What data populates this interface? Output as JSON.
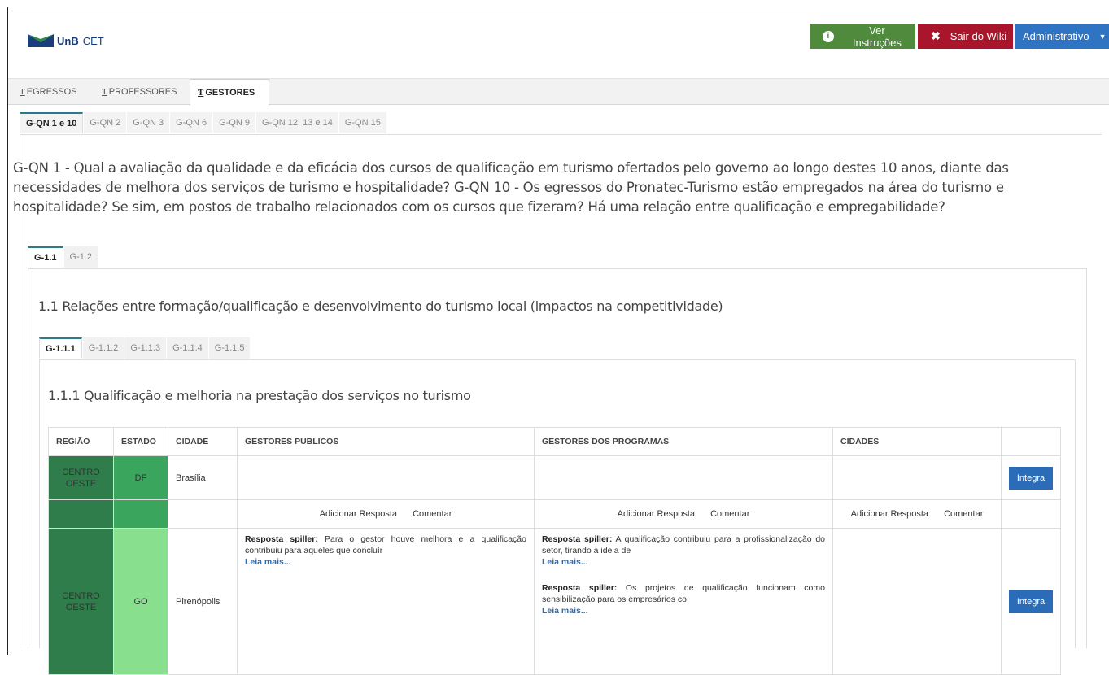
{
  "header": {
    "logo_unb": "UnB",
    "logo_cet": "CET",
    "instructions_label": "Ver Instruções",
    "exit_label": "Sair do Wiki",
    "admin_label": "Administrativo"
  },
  "main_tabs": [
    {
      "label": "EGRESSOS",
      "active": false
    },
    {
      "label": "PROFESSORES",
      "active": false
    },
    {
      "label": "GESTORES",
      "active": true
    }
  ],
  "qn_tabs": [
    "G-QN 1 e 10",
    "G-QN 2",
    "G-QN 3",
    "G-QN 6",
    "G-QN 9",
    "G-QN 12, 13 e 14",
    "G-QN 15"
  ],
  "qn_title": "G-QN 1 - Qual a avaliação da qualidade e da eficácia dos cursos de qualificação em turismo ofertados pelo governo ao longo destes 10 anos, diante das necessidades de melhora dos serviços de turismo e hospitalidade? G-QN 10 - Os egressos do Pronatec-Turismo estão empregados na área do turismo e hospitalidade? Se sim, em postos de trabalho relacionados com os cursos que fizeram? Há uma relação entre qualificação e empregabilidade?",
  "g1_tabs": [
    "G-1.1",
    "G-1.2"
  ],
  "g11_title": "1.1 Relações entre formação/qualificação e desenvolvimento do turismo local (impactos na competitividade)",
  "g111_tabs": [
    "G-1.1.1",
    "G-1.1.2",
    "G-1.1.3",
    "G-1.1.4",
    "G-1.1.5"
  ],
  "g111_title": "1.1.1 Qualificação e melhoria na prestação dos serviços no turismo",
  "table": {
    "headers": [
      "REGIÃO",
      "ESTADO",
      "CIDADE",
      "GESTORES PUBLICOS",
      "GESTORES DOS PROGRAMAS",
      "CIDADES",
      ""
    ],
    "rows": [
      {
        "region_line1": "CENTRO",
        "region_line2": "OESTE",
        "estado": "DF",
        "cidade": "Brasília",
        "integra": "Integra"
      },
      {
        "region_line1": "CENTRO",
        "region_line2": "OESTE",
        "estado": "GO",
        "cidade": "Pirenópolis",
        "integra": "Integra"
      }
    ],
    "actions": {
      "add": "Adicionar Resposta",
      "comment": "Comentar"
    },
    "responses": {
      "label": "Resposta spiller:",
      "more": "Leia mais...",
      "gestores_publicos": [
        "Para o gestor houve melhora e a qualificação contribuiu para aqueles que concluír"
      ],
      "gestores_programas": [
        "A qualificação contribuiu para a profissionalização do setor, tirando a ideia de",
        "Os projetos de qualificação funcionam como sensibilização para os empresários co"
      ]
    }
  }
}
